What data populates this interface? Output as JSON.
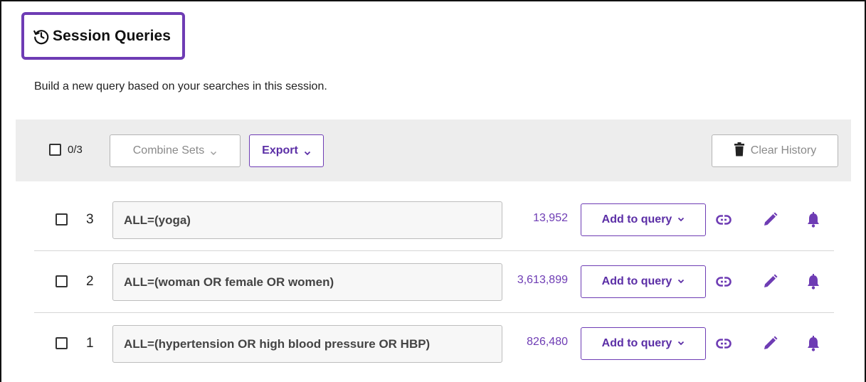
{
  "header": {
    "title": "Session Queries",
    "title_icon": "history-icon",
    "subtitle": "Build a new query based on your searches in this session."
  },
  "toolbar": {
    "selected_count": "0/3",
    "combine_label": "Combine Sets",
    "export_label": "Export",
    "clear_label": "Clear History",
    "clear_icon": "trash-icon"
  },
  "rows": [
    {
      "set_number": "3",
      "query": "ALL=(yoga)",
      "hits": "13,952",
      "add_label": "Add to query"
    },
    {
      "set_number": "2",
      "query": "ALL=(woman OR female OR women)",
      "hits": "3,613,899",
      "add_label": "Add to query"
    },
    {
      "set_number": "1",
      "query": "ALL=(hypertension OR high blood pressure OR HBP)",
      "hits": "826,480",
      "add_label": "Add to query"
    }
  ],
  "row_icons": [
    "link-icon",
    "pencil-icon",
    "bell-icon"
  ],
  "colors": {
    "accent": "#6e3cb4",
    "toolbar_bg": "#ededed",
    "disabled_text": "#8a8a8a"
  }
}
